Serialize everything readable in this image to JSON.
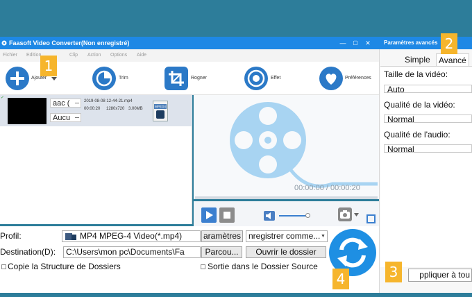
{
  "window": {
    "title": "Faasoft Video Converter(Non enregistré)",
    "controls": [
      "—",
      "▢",
      "✕"
    ]
  },
  "menu": [
    "Fichier",
    "Edition",
    "Clip",
    "Action",
    "Options",
    "Aide"
  ],
  "toolbar": {
    "add": "Ajouter",
    "trim": "Trim",
    "crop": "Rogner",
    "effect": "Effet",
    "preferences": "Préférences"
  },
  "file": {
    "audio": "aac (",
    "subtitle": "Aucu",
    "name": "2019-08-08 12-44-21.mp4",
    "duration": "00:00:20",
    "resolution": "1280x720",
    "size": "3.00MB",
    "format_badge": "MPEG4"
  },
  "preview": {
    "time": "00:00:00 / 00:00:20"
  },
  "bottom": {
    "profile_label": "Profil:",
    "profile_value": "MP4 MPEG-4 Video(*.mp4)",
    "params_button": "aramètres",
    "save_as_button": "nregistrer comme...",
    "destination_label": "Destination(D):",
    "destination_value": "C:\\Users\\mon pc\\Documents\\Fa",
    "browse_button": "Parcou...",
    "open_folder_button": "Ouvrir le dossier",
    "copy_structure": "Copie la Structure de Dossiers",
    "output_source": "Sortie dans le Dossier Source"
  },
  "settings": {
    "title": "Paramètres avancés",
    "tab_simple": "Simple",
    "tab_advanced": "Avancé",
    "video_size_label": "Taille de la vidéo:",
    "video_size_value": "Auto",
    "video_quality_label": "Qualité de la vidéo:",
    "video_quality_value": "Normal",
    "audio_quality_label": "Qualité de l'audio:",
    "audio_quality_value": "Normal",
    "apply_button": "ppliquer à tou"
  },
  "markers": [
    "1",
    "2",
    "3",
    "4"
  ],
  "colors": {
    "background": "#2d7d9a",
    "titlebar": "#1e88e5",
    "accent": "#2b79c7",
    "marker": "#f6b52c"
  }
}
